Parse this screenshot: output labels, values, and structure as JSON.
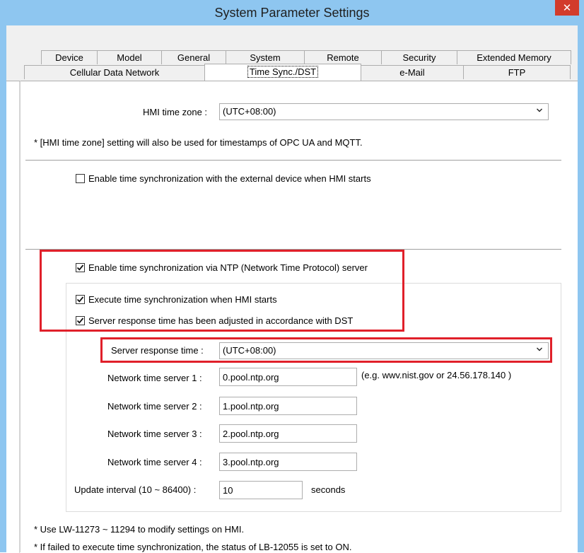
{
  "window": {
    "title": "System Parameter Settings",
    "close_symbol": "✕"
  },
  "tabs_row1": [
    "Device",
    "Model",
    "General",
    "System",
    "Remote",
    "Security",
    "Extended Memory"
  ],
  "tabs_row2": [
    "Cellular Data Network",
    "Time Sync./DST",
    "e-Mail",
    "FTP"
  ],
  "active_tab": "Time Sync./DST",
  "hmi_time_zone": {
    "label": "HMI time zone :",
    "value": "(UTC+08:00)"
  },
  "note_timestamps": "* [HMI time zone] setting will also be used for timestamps of OPC UA and MQTT.",
  "ext_sync": {
    "label": "Enable time synchronization with the external device when HMI starts",
    "checked": false
  },
  "ntp": {
    "enable_label": "Enable time synchronization via NTP (Network Time Protocol) server",
    "enable_checked": true,
    "exec_label": "Execute time synchronization when HMI starts",
    "exec_checked": true,
    "dst_label": "Server response time has been adjusted in accordance with DST",
    "dst_checked": true,
    "response_label": "Server response time :",
    "response_value": "(UTC+08:00)",
    "servers": [
      {
        "label": "Network time server 1 :",
        "value": "0.pool.ntp.org"
      },
      {
        "label": "Network time server 2 :",
        "value": "1.pool.ntp.org"
      },
      {
        "label": "Network time server 3 :",
        "value": "2.pool.ntp.org"
      },
      {
        "label": "Network time server 4 :",
        "value": "3.pool.ntp.org"
      }
    ],
    "server_example": "(e.g. wwv.nist.gov or 24.56.178.140 )",
    "interval_label": "Update interval (10 ~ 86400) :",
    "interval_value": "10",
    "interval_unit": "seconds"
  },
  "footnotes": [
    "* Use LW-11273 ~ 11294 to modify settings on HMI.",
    "* If failed to execute time synchronization, the status of LB-12055 is set to ON."
  ],
  "colors": {
    "titlebar": "#8ec6f0",
    "close": "#d23b2b",
    "highlight": "#e0202a"
  }
}
